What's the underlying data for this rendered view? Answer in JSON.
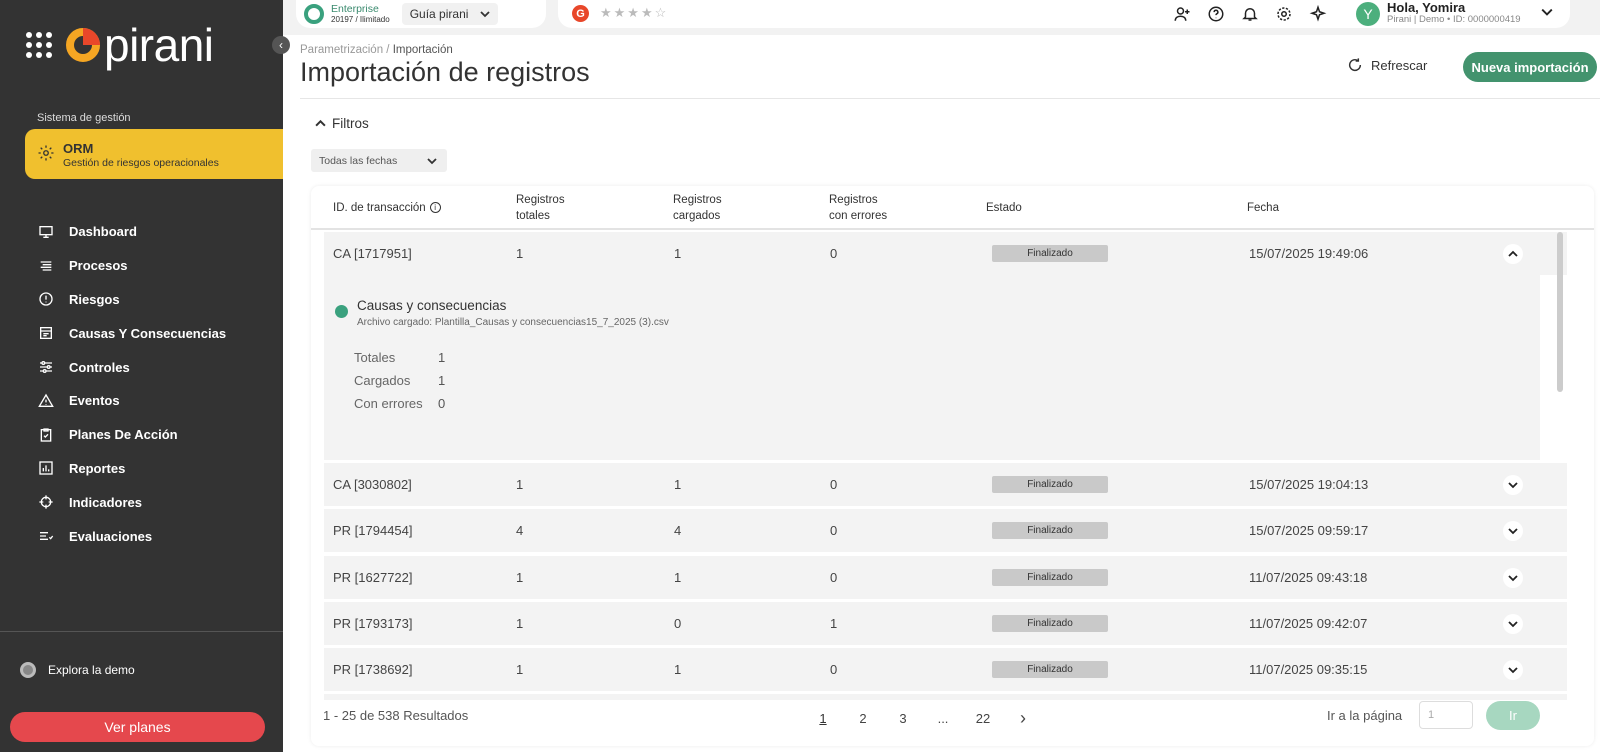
{
  "sidebar": {
    "logo_text": "pirani",
    "system_label": "Sistema de gestión",
    "system": {
      "title": "ORM",
      "subtitle": "Gestión de riesgos operacionales"
    },
    "items": [
      {
        "label": "Dashboard",
        "icon": "monitor-icon"
      },
      {
        "label": "Procesos",
        "icon": "list-icon"
      },
      {
        "label": "Riesgos",
        "icon": "alert-circle-icon"
      },
      {
        "label": "Causas Y Consecuencias",
        "icon": "inbox-icon"
      },
      {
        "label": "Controles",
        "icon": "sliders-icon"
      },
      {
        "label": "Eventos",
        "icon": "warning-triangle-icon"
      },
      {
        "label": "Planes De Acción",
        "icon": "clipboard-check-icon"
      },
      {
        "label": "Reportes",
        "icon": "bar-chart-icon"
      },
      {
        "label": "Indicadores",
        "icon": "crosshair-icon"
      },
      {
        "label": "Evaluaciones",
        "icon": "checklist-icon"
      }
    ],
    "demo_label": "Explora la demo",
    "plans_button": "Ver planes"
  },
  "topbar": {
    "plan_name": "Enterprise",
    "plan_sub": "20197 / Ilimitado",
    "guide_label": "Guía pirani",
    "g_badge": "G",
    "stars": "★★★★☆",
    "user_initial": "Y",
    "user_greeting": "Hola, Yomira",
    "user_sub": "Pirani | Demo • ID: 0000000419"
  },
  "page": {
    "breadcrumb_parent": "Parametrización",
    "breadcrumb_sep": " / ",
    "breadcrumb_current": "Importación",
    "title": "Importación de registros",
    "refresh_label": "Refrescar",
    "new_import_label": "Nueva importación",
    "filters_label": "Filtros",
    "date_filter": "Todas las fechas"
  },
  "table": {
    "headers": {
      "id": "ID. de transacción",
      "total_1": "Registros",
      "total_2": "totales",
      "loaded_1": "Registros",
      "loaded_2": "cargados",
      "errors_1": "Registros",
      "errors_2": "con errores",
      "status": "Estado",
      "date": "Fecha"
    },
    "rows": [
      {
        "id": "CA [1717951]",
        "total": "1",
        "loaded": "1",
        "errors": "0",
        "status": "Finalizado",
        "date": "15/07/2025 19:49:06"
      },
      {
        "id": "CA [3030802]",
        "total": "1",
        "loaded": "1",
        "errors": "0",
        "status": "Finalizado",
        "date": "15/07/2025 19:04:13"
      },
      {
        "id": "PR [1794454]",
        "total": "4",
        "loaded": "4",
        "errors": "0",
        "status": "Finalizado",
        "date": "15/07/2025 09:59:17"
      },
      {
        "id": "PR [1627722]",
        "total": "1",
        "loaded": "1",
        "errors": "0",
        "status": "Finalizado",
        "date": "11/07/2025 09:43:18"
      },
      {
        "id": "PR [1793173]",
        "total": "1",
        "loaded": "0",
        "errors": "1",
        "status": "Finalizado",
        "date": "11/07/2025 09:42:07"
      },
      {
        "id": "PR [1738692]",
        "total": "1",
        "loaded": "1",
        "errors": "0",
        "status": "Finalizado",
        "date": "11/07/2025 09:35:15"
      }
    ],
    "expanded": {
      "title": "Causas y consecuencias",
      "file": "Archivo cargado: Plantilla_Causas y consecuencias15_7_2025 (3).csv",
      "stats": [
        {
          "label": "Totales",
          "value": "1"
        },
        {
          "label": "Cargados",
          "value": "1"
        },
        {
          "label": "Con errores",
          "value": "0"
        }
      ]
    }
  },
  "pagination": {
    "results": "1 - 25 de 538 Resultados",
    "pages": [
      "1",
      "2",
      "3",
      "...",
      "22"
    ],
    "next": "›",
    "goto_label": "Ir a la página",
    "goto_placeholder": "1",
    "go_button": "Ir"
  },
  "colors": {
    "accent": "#43936e",
    "brand_yellow": "#f0c02e",
    "sidebar_bg": "#333333",
    "danger": "#e5484d"
  }
}
